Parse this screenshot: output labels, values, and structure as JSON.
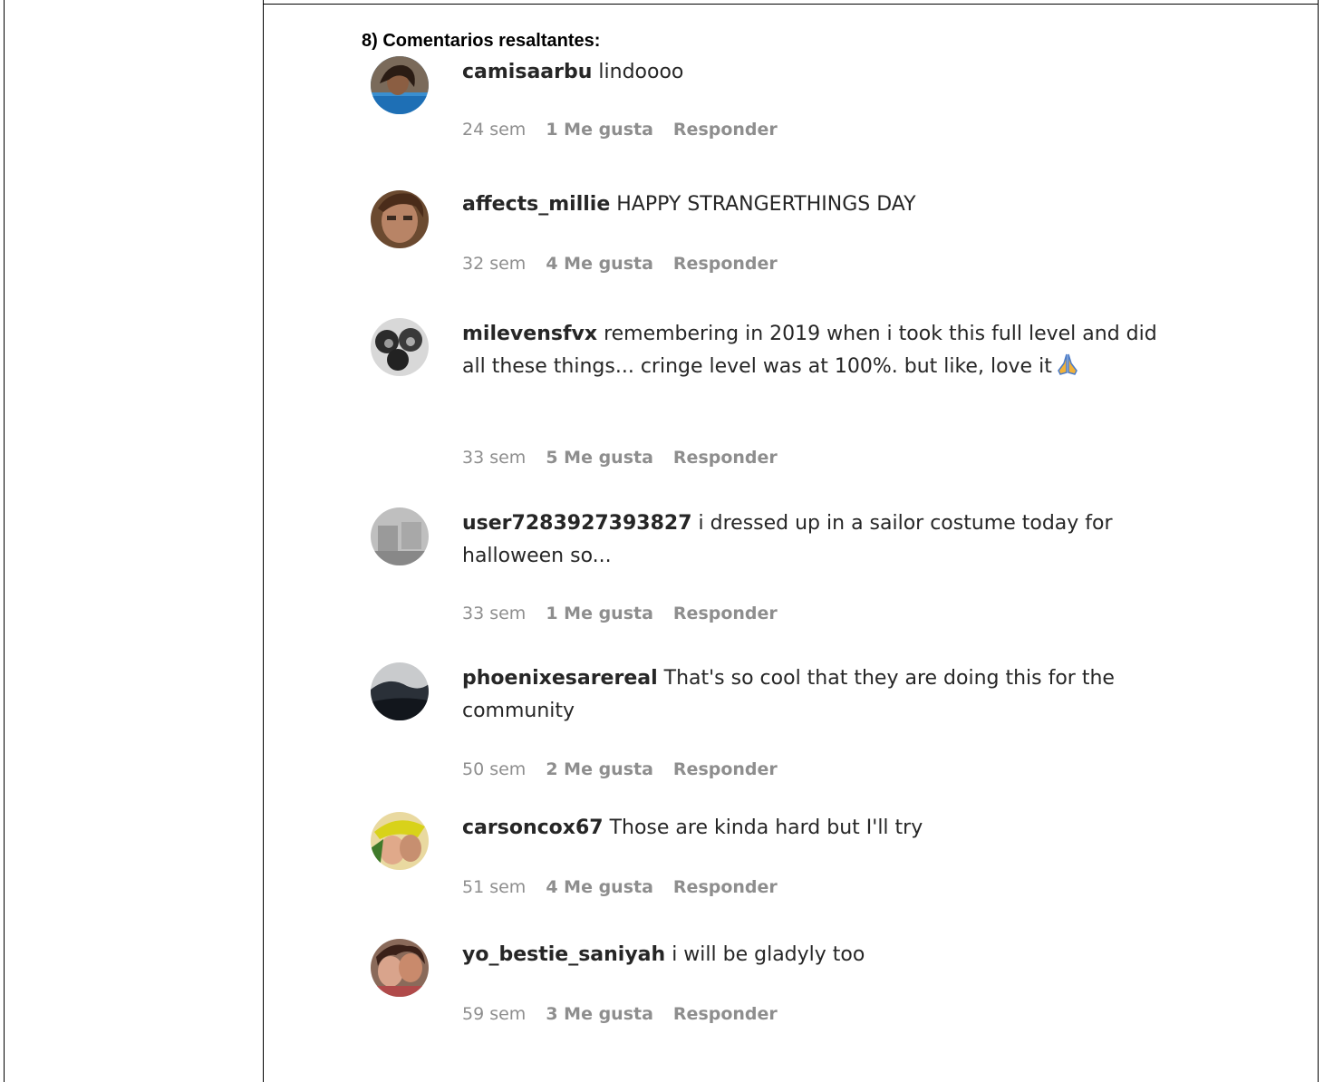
{
  "heading": "8) Comentarios resaltantes:",
  "comments": [
    {
      "user": "camisaarbu",
      "text": "lindoooo",
      "time": "24 sem",
      "likes": "1 Me gusta",
      "reply": "Responder",
      "avatar": "camisaarbu-avatar"
    },
    {
      "user": "affects_millie",
      "text": "HAPPY STRANGERTHINGS DAY",
      "time": "32 sem",
      "likes": "4 Me gusta",
      "reply": "Responder",
      "avatar": "affects-millie-avatar"
    },
    {
      "user": "milevensfvx",
      "text": "remembering in 2019 when i took this full level and did all these things... cringe level was at 100%. but like, love it",
      "emoji": "folded-hands-icon",
      "time": "33 sem",
      "likes": "5 Me gusta",
      "reply": "Responder",
      "avatar": "milevensfvx-avatar"
    },
    {
      "user": "user7283927393827",
      "text": "i dressed up in a sailor costume today for halloween so...",
      "time": "33 sem",
      "likes": "1 Me gusta",
      "reply": "Responder",
      "avatar": "user-avatar"
    },
    {
      "user": "phoenixesarereal",
      "text": "That's so cool that they are doing this for the community",
      "time": "50 sem",
      "likes": "2 Me gusta",
      "reply": "Responder",
      "avatar": "phoenixesarereal-avatar"
    },
    {
      "user": "carsoncox67",
      "text": "Those are kinda hard but I'll try",
      "time": "51 sem",
      "likes": "4 Me gusta",
      "reply": "Responder",
      "avatar": "carsoncox67-avatar"
    },
    {
      "user": "yo_bestie_saniyah",
      "text": "i will be gladyly too",
      "time": "59 sem",
      "likes": "3 Me gusta",
      "reply": "Responder",
      "avatar": "yo-bestie-saniyah-avatar"
    }
  ]
}
